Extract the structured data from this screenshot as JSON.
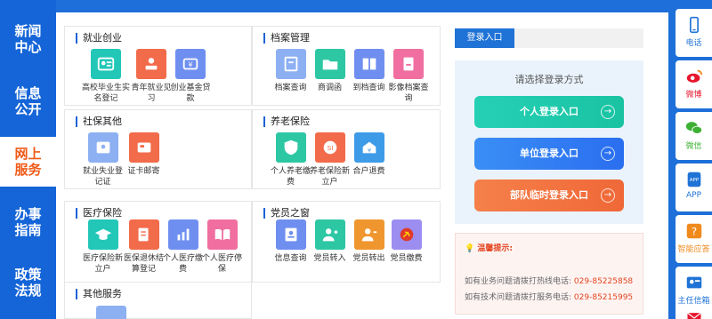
{
  "nav": [
    {
      "label": "新闻中心",
      "active": false
    },
    {
      "label": "信息公开",
      "active": false
    },
    {
      "label": "网上服务",
      "active": true
    },
    {
      "label": "办事指南",
      "active": false
    },
    {
      "label": "政策法规",
      "active": false
    }
  ],
  "sections": {
    "employment": {
      "title": "就业创业",
      "items": [
        "高校毕业生实名登记",
        "青年就业见习",
        "创业基金贷款"
      ]
    },
    "archives": {
      "title": "档案管理",
      "items": [
        "档案查询",
        "商调函",
        "到档查询",
        "影像档案查询"
      ]
    },
    "social": {
      "title": "社保其他",
      "items": [
        "就业失业登记证",
        "证卡邮寄"
      ]
    },
    "pension": {
      "title": "养老保险",
      "items": [
        "个人养老缴费",
        "养老保险新立户",
        "合户退费"
      ]
    },
    "medical": {
      "title": "医疗保险",
      "items": [
        "医疗保险新立户",
        "医保退休结算登记",
        "个人医疗缴费",
        "个人医疗停保"
      ]
    },
    "party": {
      "title": "党员之窗",
      "items": [
        "信息查询",
        "党员转入",
        "党员转出",
        "党员缴费"
      ]
    },
    "other": {
      "title": "其他服务"
    }
  },
  "login": {
    "tab": "登录入口",
    "choose": "请选择登录方式",
    "buttons": [
      "个人登录入口",
      "单位登录入口",
      "部队临时登录入口"
    ]
  },
  "tips": {
    "title": "温馨提示:",
    "line1": "如有业务问题请拨打热线电话:",
    "phone1": "029-85225858",
    "line2": "如有技术问题请拨打服务电话:",
    "phone2": "029-85215995"
  },
  "rightbar": [
    "电话",
    "微博",
    "微信",
    "APP",
    "智能应答",
    "主任信箱"
  ],
  "colors": {
    "brand": "#1565d8",
    "accent": "#ef5a17",
    "teal": "#22c7a9",
    "blue": "#2f7bf0",
    "orange": "#f2683a"
  }
}
